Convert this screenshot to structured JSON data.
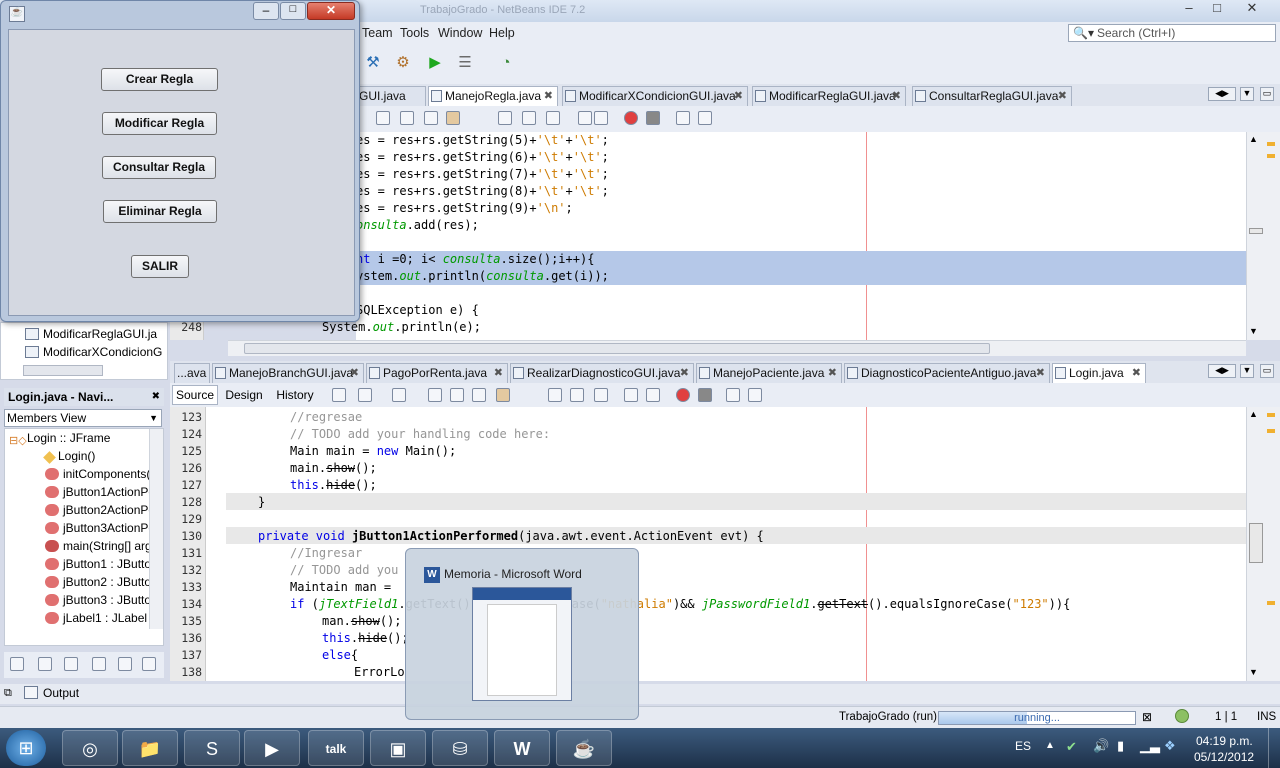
{
  "ide": {
    "title_faded": "TrabajoGrado - NetBeans IDE 7.2",
    "menu": [
      "Team",
      "Tools",
      "Window",
      "Help"
    ],
    "search_placeholder": "Search (Ctrl+I)",
    "top_tabs": [
      "GUI.java",
      "ManejoRegla.java",
      "ModificarXCondicionGUI.java",
      "ModificarReglaGUI.java",
      "ConsultarReglaGUI.java"
    ],
    "top_editor": {
      "lines": [
        {
          "num": "",
          "text": "es = res+rs.getString(5)+'\\t'+'\\t';"
        },
        {
          "num": "",
          "text": "es = res+rs.getString(6)+'\\t'+'\\t';"
        },
        {
          "num": "",
          "text": "es = res+rs.getString(7)+'\\t'+'\\t';"
        },
        {
          "num": "",
          "text": "es = res+rs.getString(8)+'\\t'+'\\t';"
        },
        {
          "num": "",
          "text": "es = res+rs.getString(9)+'\\n';"
        },
        {
          "num": "",
          "text": "onsulta.add(res);"
        },
        {
          "num": "",
          "text": ""
        },
        {
          "num": "",
          "text": "nt i =0; i< consulta.size();i++){"
        },
        {
          "num": "",
          "text": "ystem.out.println(consulta.get(i));"
        },
        {
          "num": "",
          "text": ""
        },
        {
          "num": "",
          "text": "SQLException e) {"
        },
        {
          "num": "248",
          "text": "System.out.println(e);"
        }
      ]
    },
    "bottom_tabs": [
      "...ava",
      "ManejoBranchGUI.java",
      "PagoPorRenta.java",
      "RealizarDiagnosticoGUI.java",
      "ManejoPaciente.java",
      "DiagnosticoPacienteAntiguo.java",
      "Login.java"
    ],
    "editor_modes": [
      "Source",
      "Design",
      "History"
    ],
    "bottom_editor": {
      "lines": [
        {
          "num": "123",
          "text": "//regresae"
        },
        {
          "num": "124",
          "text": "// TODO add your handling code here:"
        },
        {
          "num": "125",
          "text": "Main main = new Main();"
        },
        {
          "num": "126",
          "text": "main.show();"
        },
        {
          "num": "127",
          "text": "this.hide();"
        },
        {
          "num": "128",
          "text": "}"
        },
        {
          "num": "129",
          "text": ""
        },
        {
          "num": "130",
          "text": "private void jButton1ActionPerformed(java.awt.event.ActionEvent evt) {"
        },
        {
          "num": "131",
          "text": "//Ingresar"
        },
        {
          "num": "132",
          "text": "// TODO add you"
        },
        {
          "num": "133",
          "text": "Maintain man ="
        },
        {
          "num": "134",
          "text": "if (jTextField1.getText().equalsIgnoreCase(\"nathalia\")&& jPasswordField1.getText().equalsIgnoreCase(\"123\")){"
        },
        {
          "num": "135",
          "text": "man.show();"
        },
        {
          "num": "136",
          "text": "this.hide();"
        },
        {
          "num": "137",
          "text": "else{"
        },
        {
          "num": "138",
          "text": "ErrorLo"
        }
      ]
    },
    "files_panel": [
      "ModificarReglaGUI.ja",
      "ModificarXCondicionG"
    ],
    "navigator": {
      "title": "Login.java - Navi...",
      "view": "Members View",
      "items": [
        "Login :: JFrame",
        "Login()",
        "initComponents()",
        "jButton1ActionPe",
        "jButton2ActionPe",
        "jButton3ActionPe",
        "main(String[] arg",
        "jButton1 : JButto",
        "jButton2 : JButto",
        "jButton3 : JButto",
        "jLabel1 : JLabel"
      ]
    },
    "output_label": "Output",
    "status": {
      "project": "TrabajoGrado (run)",
      "progress_text": "running...",
      "progress": 0.45,
      "position": "1 | 1",
      "mode": "INS"
    }
  },
  "dialog": {
    "buttons": [
      "Crear Regla",
      "Modificar Regla",
      "Consultar Regla",
      "Eliminar Regla",
      "SALIR"
    ]
  },
  "thumbnail": {
    "title": "Memoria - Microsoft Word"
  },
  "taskbar": {
    "apps": [
      "chrome-icon",
      "explorer-icon",
      "skype-icon",
      "media-icon",
      "gtalk-icon",
      "virtualbox-icon",
      "database-run-icon",
      "word-icon",
      "java-icon"
    ],
    "lang": "ES",
    "time": "04:19 p.m.",
    "date": "05/12/2012"
  },
  "colors": {
    "selection": "#b5c8e8",
    "keyword": "#0000e6",
    "field": "#009900",
    "string": "#ce7b00",
    "comment": "#969696",
    "taskbar": "#1d3048"
  }
}
